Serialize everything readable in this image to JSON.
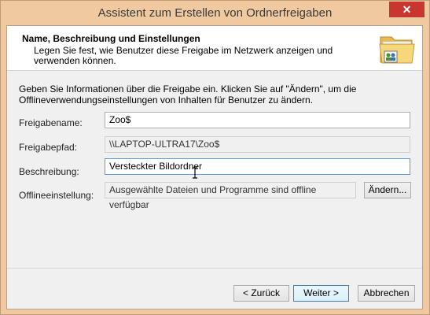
{
  "window": {
    "title": "Assistent zum Erstellen von Ordnerfreigaben",
    "close_symbol": "✕"
  },
  "header": {
    "title": "Name, Beschreibung und Einstellungen",
    "subtitle": "Legen Sie fest, wie Benutzer diese Freigabe im Netzwerk anzeigen und verwenden können.",
    "icon": "shared-folder-icon"
  },
  "intro": "Geben Sie Informationen über die Freigabe ein. Klicken Sie auf \"Ändern\", um die Offlineverwendungseinstellungen von Inhalten für Benutzer zu ändern.",
  "fields": {
    "share_name_label": "Freigabename:",
    "share_name_value": "Zoo$",
    "share_path_label": "Freigabepfad:",
    "share_path_value": "\\\\LAPTOP-ULTRA17\\Zoo$",
    "description_label": "Beschreibung:",
    "description_value": "Versteckter Bildordner",
    "offline_label": "Offlineeinstellung:",
    "offline_value": "Ausgewählte Dateien und Programme sind offline verfügbar",
    "change_button": "Ändern..."
  },
  "buttons": {
    "back": "< Zurück",
    "next": "Weiter >",
    "cancel": "Abbrechen"
  },
  "colors": {
    "frame": "#f1c9a0",
    "close": "#c7372f",
    "focus_border": "#569de5"
  }
}
